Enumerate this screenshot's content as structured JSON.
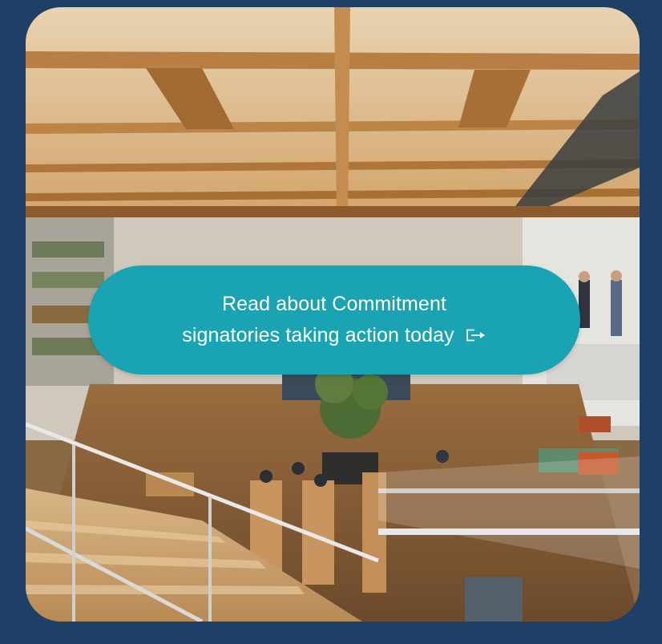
{
  "cta": {
    "line1": "Read about Commitment",
    "line2": "signatories taking action today",
    "icon": "exit-arrow-icon"
  },
  "colors": {
    "page_background": "#1e3f66",
    "cta_background": "#1aa3b3",
    "cta_text": "#ffffff"
  },
  "image": {
    "subject": "office-atrium-photo"
  }
}
